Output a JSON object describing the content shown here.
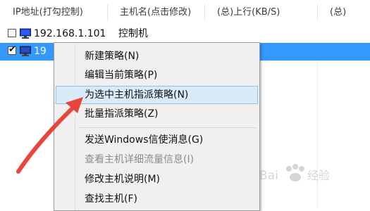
{
  "columns": [
    "IP地址(打勾控制)",
    "主机名(点击修改)",
    "(总)上行(KB/S)",
    "(总)"
  ],
  "rows": [
    {
      "checked": false,
      "ip": "192.168.1.101",
      "host": "控制机",
      "icon": "monitor-icon"
    },
    {
      "checked": true,
      "ip": "19",
      "host": "",
      "icon": "monitor-icon",
      "selected": true
    }
  ],
  "context_menu": {
    "items": [
      {
        "label": "新建策略(N)",
        "enabled": true
      },
      {
        "label": "编辑当前策略(P)",
        "enabled": true
      },
      {
        "label": "为选中主机指派策略(N)",
        "enabled": true,
        "highlighted": true
      },
      {
        "label": "批量指派策略(Z)",
        "enabled": true
      },
      {
        "label": "发送Windows信使消息(G)",
        "enabled": true
      },
      {
        "label": "查看主机详细流量信息(I)",
        "enabled": false
      },
      {
        "label": "修改主机说明(M)",
        "enabled": true
      },
      {
        "label": "查找主机(F)",
        "enabled": true
      }
    ]
  },
  "colors": {
    "selection": "#3399ff",
    "highlight": "#d9ebf9",
    "arrow": "#e8463a"
  },
  "watermark": {
    "text": "Bai 经验"
  }
}
